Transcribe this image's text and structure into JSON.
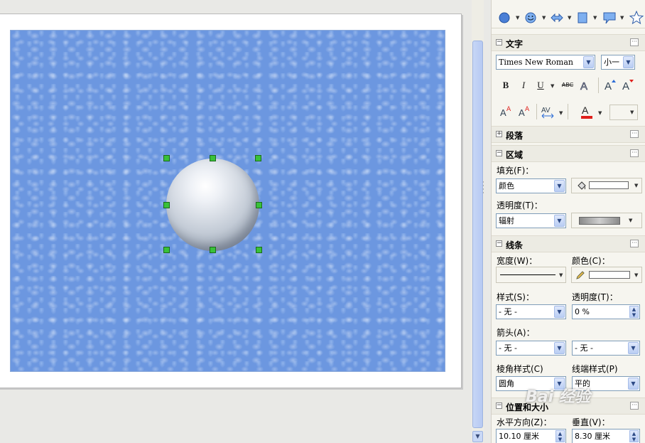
{
  "panel": {
    "font_section": {
      "title": "文字",
      "font_name": "Times New Roman",
      "font_size": "小一",
      "bold_label": "B",
      "italic_label": "I",
      "underline_label": "U",
      "strike_label": "ABC"
    },
    "paragraph_section": {
      "title": "段落"
    },
    "area_section": {
      "title": "区域",
      "fill_label": "填充(F)：",
      "fill_value": "颜色",
      "transparency_label": "透明度(T)：",
      "transparency_value": "辐射"
    },
    "line_section": {
      "title": "线条",
      "width_label": "宽度(W)：",
      "color_label": "颜色(C)：",
      "style_label": "样式(S)：",
      "style_value": "- 无 -",
      "line_transparency_label": "透明度(T)：",
      "line_transparency_value": "0 %",
      "arrow_label": "箭头(A)：",
      "arrow_start_value": "- 无 -",
      "arrow_end_value": "- 无 -",
      "corner_label": "棱角样式(C)",
      "corner_value": "圆角",
      "cap_label": "线端样式(P)",
      "cap_value": "平的"
    },
    "position_section": {
      "title": "位置和大小",
      "horizontal_label": "水平方向(Z)：",
      "horizontal_value": "10.10 厘米",
      "vertical_label": "垂直(V)：",
      "vertical_value": "8.30 厘米"
    }
  },
  "watermark": {
    "text": "Bai 经验"
  },
  "colors": {
    "slide_texture": "#6c97e0",
    "handle": "#39c139",
    "font_color_bar": "#e0201c"
  }
}
